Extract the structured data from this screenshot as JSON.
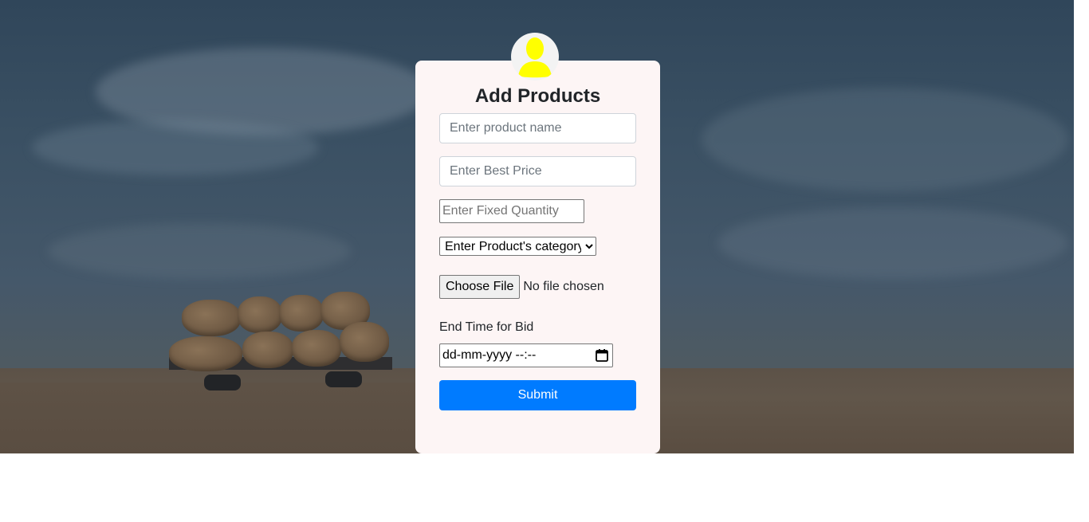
{
  "form": {
    "title": "Add Products",
    "product_name_placeholder": "Enter product name",
    "best_price_placeholder": "Enter Best Price",
    "fixed_quantity_placeholder": "Enter Fixed Quantity",
    "category_selected": "Enter Product's category",
    "file_button_label": "Choose File",
    "file_status": "No file chosen",
    "end_time_label": "End Time for Bid",
    "end_time_value": "dd-mm-yyyy --:--",
    "submit_label": "Submit"
  },
  "icons": {
    "avatar": "user-silhouette-icon",
    "calendar": "calendar-icon"
  },
  "colors": {
    "avatar_figure": "#ffff00",
    "submit_bg": "#007bff",
    "card_bg": "#fdf5f5"
  }
}
